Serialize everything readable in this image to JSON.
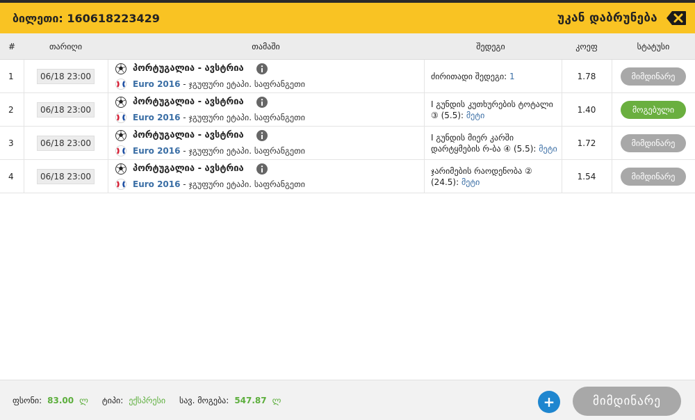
{
  "header": {
    "ticket_label": "ბილეთი: 160618223429",
    "back_label": "უკან დაბრუნება"
  },
  "table": {
    "headers": {
      "num": "#",
      "date": "თარიღი",
      "game": "თამაში",
      "event": "შედეგი",
      "odds": "კოეფ",
      "status": "სტატუსი"
    },
    "rows": [
      {
        "num": "1",
        "date": "06/18 23:00",
        "teams": "პორტუგალია - ავსტრია",
        "tournament": "Euro 2016",
        "stage": " - ჯგუფური ეტაპი. საფრანგეთი",
        "event_text": "ძირითადი შედეგი: ",
        "event_value": "1",
        "odds": "1.78",
        "status": "მიმდინარე",
        "status_color": "#a8a8a8"
      },
      {
        "num": "2",
        "date": "06/18 23:00",
        "teams": "პორტუგალია - ავსტრია",
        "tournament": "Euro 2016",
        "stage": " - ჯგუფური ეტაპი. საფრანგეთი",
        "event_text": "I გუნდის კუთხურების ტოტალი ③ (5.5): ",
        "event_value": "მეტი",
        "odds": "1.40",
        "status": "მოგებული",
        "status_color": "#6aaf3f"
      },
      {
        "num": "3",
        "date": "06/18 23:00",
        "teams": "პორტუგალია - ავსტრია",
        "tournament": "Euro 2016",
        "stage": " - ჯგუფური ეტაპი. საფრანგეთი",
        "event_text": "I გუნდის მიერ კარში დარტყმების რ-ბა ④ (5.5): ",
        "event_value": "მეტი",
        "odds": "1.72",
        "status": "მიმდინარე",
        "status_color": "#a8a8a8"
      },
      {
        "num": "4",
        "date": "06/18 23:00",
        "teams": "პორტუგალია - ავსტრია",
        "tournament": "Euro 2016",
        "stage": " - ჯგუფური ეტაპი. საფრანგეთი",
        "event_text": "ჯარიმების რაოდენობა ② (24.5): ",
        "event_value": "მეტი",
        "odds": "1.54",
        "status": "მიმდინარე",
        "status_color": "#a8a8a8"
      }
    ]
  },
  "footer": {
    "stake_label": "ფსონი:",
    "stake_value": "83.00",
    "currency": "ლ",
    "type_label": "ტიპი:",
    "type_value": "ექსპრესი",
    "win_label": "სავ. მოგება:",
    "win_value": "547.87",
    "plus_label": "+",
    "main_status": "მიმდინარე"
  },
  "colors": {
    "header_bg": "#f9c323",
    "win_green": "#6aaf3f",
    "pending_grey": "#a8a8a8",
    "link_blue": "#3a6ea5",
    "plus_blue": "#1f86cf"
  },
  "icons": {
    "back": "backspace-icon",
    "info": "info-icon",
    "ball": "football-icon",
    "flag": "euro-flag-icon"
  }
}
